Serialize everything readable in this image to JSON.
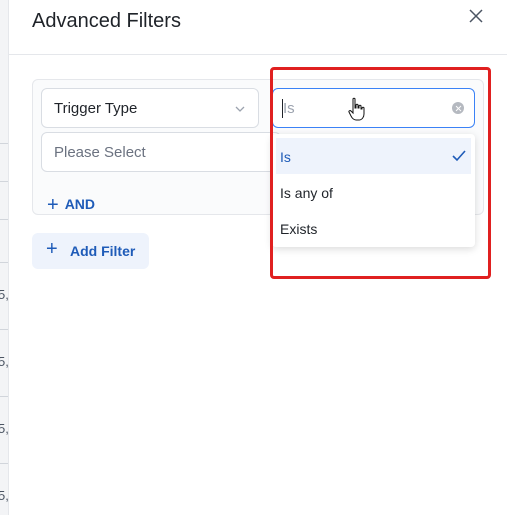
{
  "dialog": {
    "title": "Advanced Filters"
  },
  "filter_row": {
    "field": {
      "value": "Trigger Type"
    },
    "operator": {
      "value": "Is"
    },
    "value_select": {
      "placeholder": "Please Select"
    }
  },
  "actions": {
    "and_label": "AND",
    "add_filter_label": "Add Filter"
  },
  "operator_options": [
    {
      "label": "Is",
      "selected": true
    },
    {
      "label": "Is any of",
      "selected": false
    },
    {
      "label": "Exists",
      "selected": false
    }
  ],
  "background_fragments": [
    "5,",
    "5,",
    "5,",
    "5,"
  ],
  "colors": {
    "accent": "#1e5bb8",
    "focus_border": "#3b82f6",
    "highlight_border": "#e02020",
    "selected_bg": "#eef3fc"
  },
  "icons": {
    "close": "close-icon",
    "chevron": "chevron-down-icon",
    "clear": "clear-icon",
    "check": "check-icon",
    "plus": "plus-icon",
    "cursor": "hand-pointer-icon"
  }
}
